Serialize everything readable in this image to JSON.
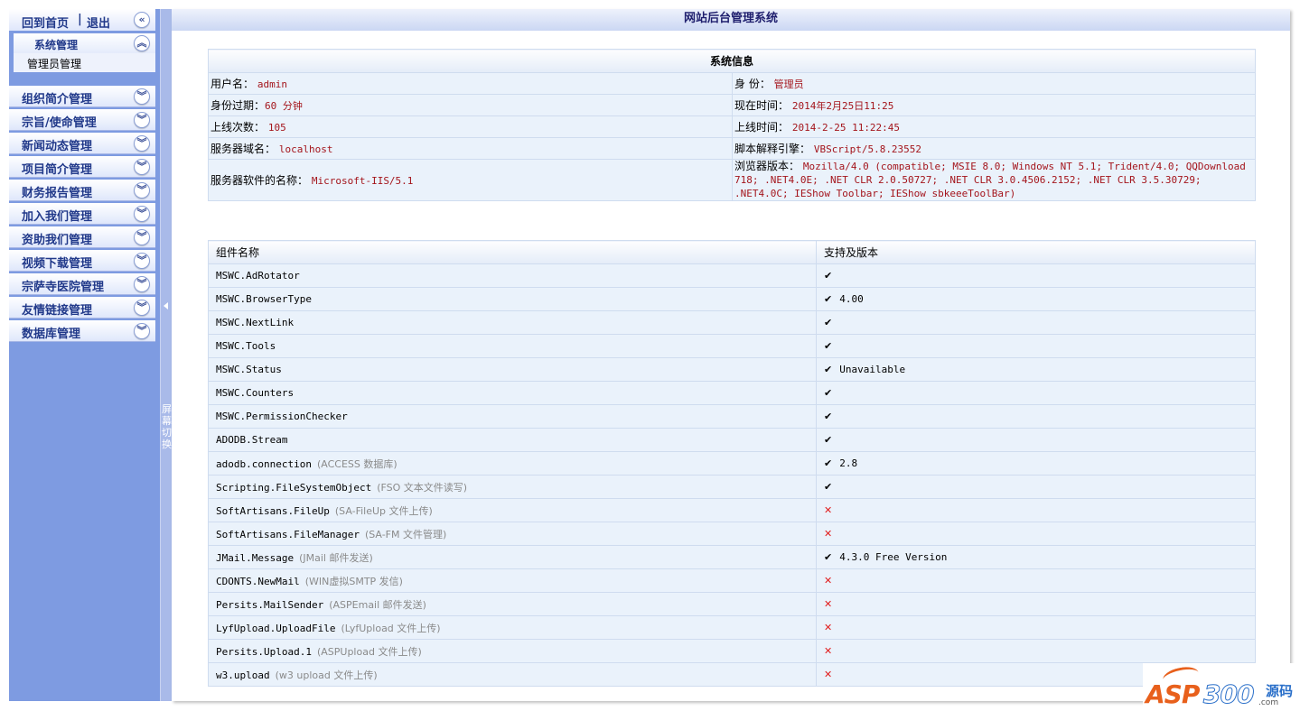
{
  "sidebar": {
    "home": "回到首页",
    "separator": "|",
    "logout": "退出",
    "system_group": "系统管理",
    "system_item": "管理员管理",
    "menus": [
      "组织简介管理",
      "宗旨/使命管理",
      "新闻动态管理",
      "项目简介管理",
      "财务报告管理",
      "加入我们管理",
      "资助我们管理",
      "视频下载管理",
      "宗萨寺医院管理",
      "友情链接管理",
      "数据库管理"
    ]
  },
  "splitter": {
    "label": "屏幕切换"
  },
  "main": {
    "title": "网站后台管理系统"
  },
  "sysinfo": {
    "header": "系统信息",
    "username_label": "用户名：",
    "username": "admin",
    "identity_label": "身 份：",
    "identity": "管理员",
    "expire_label": "身份过期：",
    "expire": "60 分钟",
    "now_label": "现在时间：",
    "now": "2014年2月25日11:25",
    "logins_label": "上线次数：",
    "logins": "105",
    "last_label": "上线时间：",
    "last": "2014-2-25 11:22:45",
    "host_label": "服务器域名：",
    "host": "localhost",
    "script_label": "脚本解释引擎：",
    "script": "VBScript/5.8.23552",
    "software_label": "服务器软件的名称：",
    "software": "Microsoft-IIS/5.1",
    "browser_label": "浏览器版本：",
    "browser": "Mozilla/4.0 (compatible; MSIE 8.0; Windows NT 5.1; Trident/4.0; QQDownload 718; .NET4.0E; .NET CLR 2.0.50727; .NET CLR 3.0.4506.2152; .NET CLR 3.5.30729; .NET4.0C; IEShow Toolbar; IEShow sbkeeeToolBar)"
  },
  "components": {
    "col_name": "组件名称",
    "col_support": "支持及版本",
    "rows": [
      {
        "name": "MSWC.AdRotator",
        "desc": "",
        "ok": "✔",
        "version": ""
      },
      {
        "name": "MSWC.BrowserType",
        "desc": "",
        "ok": "✔",
        "version": "4.00"
      },
      {
        "name": "MSWC.NextLink",
        "desc": "",
        "ok": "✔",
        "version": ""
      },
      {
        "name": "MSWC.Tools",
        "desc": "",
        "ok": "✔",
        "version": ""
      },
      {
        "name": "MSWC.Status",
        "desc": "",
        "ok": "✔",
        "version": "Unavailable"
      },
      {
        "name": "MSWC.Counters",
        "desc": "",
        "ok": "✔",
        "version": ""
      },
      {
        "name": "MSWC.PermissionChecker",
        "desc": "",
        "ok": "✔",
        "version": ""
      },
      {
        "name": "ADODB.Stream",
        "desc": "",
        "ok": "✔",
        "version": ""
      },
      {
        "name": "adodb.connection",
        "desc": "(ACCESS 数据库)",
        "ok": "✔",
        "version": "2.8"
      },
      {
        "name": "Scripting.FileSystemObject",
        "desc": "(FSO 文本文件读写)",
        "ok": "✔",
        "version": ""
      },
      {
        "name": "SoftArtisans.FileUp",
        "desc": "(SA-FileUp 文件上传)",
        "ok": "✕",
        "version": ""
      },
      {
        "name": "SoftArtisans.FileManager",
        "desc": "(SA-FM 文件管理)",
        "ok": "✕",
        "version": ""
      },
      {
        "name": "JMail.Message",
        "desc": "(JMail 邮件发送)",
        "ok": "✔",
        "version": "4.3.0 Free Version"
      },
      {
        "name": "CDONTS.NewMail",
        "desc": "(WIN虚拟SMTP 发信)",
        "ok": "✕",
        "version": ""
      },
      {
        "name": "Persits.MailSender",
        "desc": "(ASPEmail 邮件发送)",
        "ok": "✕",
        "version": ""
      },
      {
        "name": "LyfUpload.UploadFile",
        "desc": "(LyfUpload 文件上传)",
        "ok": "✕",
        "version": ""
      },
      {
        "name": "Persits.Upload.1",
        "desc": "(ASPUpload 文件上传)",
        "ok": "✕",
        "version": ""
      },
      {
        "name": "w3.upload",
        "desc": "(w3 upload 文件上传)",
        "ok": "✕",
        "version": ""
      }
    ]
  },
  "logo": {
    "asp": "ASP",
    "num": "300",
    "yuan": "源码",
    "com": ".com"
  },
  "icons": {
    "collapse": "double-chevron-left-icon",
    "expand": "double-chevron-down-icon",
    "up": "double-chevron-up-icon"
  }
}
